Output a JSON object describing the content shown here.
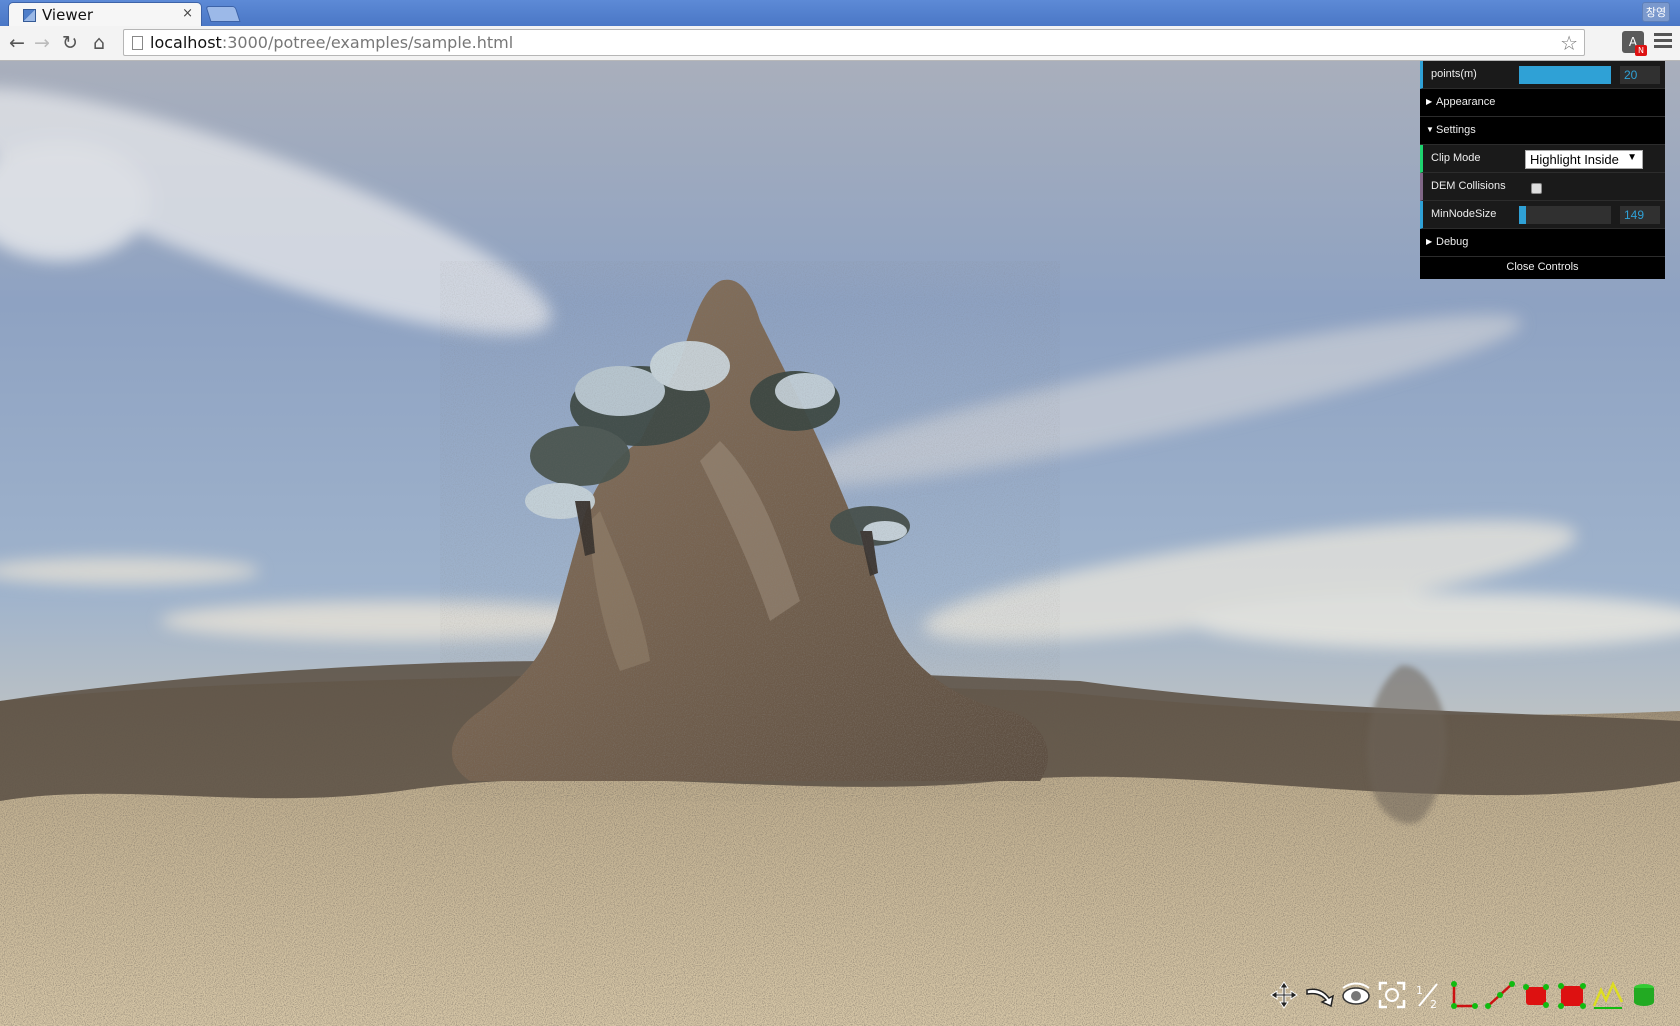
{
  "browser": {
    "tab_title": "Viewer",
    "tab_close": "×",
    "profile": "창영",
    "url_host": "localhost",
    "url_path": ":3000/potree/examples/sample.html",
    "extension_badge": "N",
    "extension_letter": "A"
  },
  "gui": {
    "points_label": "points(m)",
    "points_value": "20",
    "points_fraction": 1.0,
    "appearance_label": "Appearance",
    "settings_label": "Settings",
    "clip_mode_label": "Clip Mode",
    "clip_mode_value": "Highlight Inside",
    "dem_collisions_label": "DEM Collisions",
    "dem_collisions_checked": false,
    "min_node_size_label": "MinNodeSize",
    "min_node_size_value": "149",
    "min_node_size_fraction": 0.08,
    "debug_label": "Debug",
    "close_controls": "Close Controls"
  },
  "toolbar_icons": [
    "navigation-cross-icon",
    "fly-icon",
    "orbit-eye-icon",
    "focus-icon",
    "fraction-icon",
    "angle-icon",
    "distance-icon",
    "volume-icon",
    "clip-volume-icon",
    "height-profile-icon",
    "earth-icon"
  ]
}
